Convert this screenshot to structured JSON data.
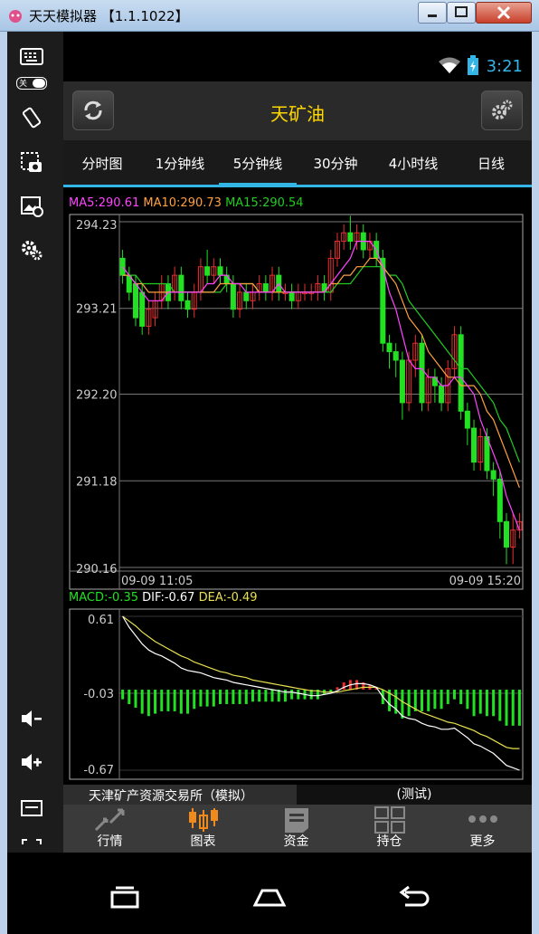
{
  "window": {
    "title": "天天模拟器 【1.1.1022】"
  },
  "status": {
    "time": "3:21"
  },
  "toolbar": {
    "keyboard_toggle": "关"
  },
  "header": {
    "title": "天矿油"
  },
  "tabs": [
    {
      "label": "分时图"
    },
    {
      "label": "1分钟线"
    },
    {
      "label": "5分钟线",
      "active": true
    },
    {
      "label": "30分钟"
    },
    {
      "label": "4小时线"
    },
    {
      "label": "日线"
    }
  ],
  "ma_legend": {
    "ma5": "MA5:290.61",
    "ma10": "MA10:290.73",
    "ma15": "MA15:290.54"
  },
  "macd_legend": {
    "macd": "MACD:-0.35",
    "dif": "DIF:-0.67",
    "dea": "DEA:-0.49"
  },
  "price_axis": [
    "294.23",
    "293.21",
    "292.20",
    "291.18",
    "290.16"
  ],
  "macd_axis": [
    "0.61",
    "-0.03",
    "-0.67"
  ],
  "time_axis": {
    "start": "09-09 11:05",
    "end": "09-09 15:20"
  },
  "colors": {
    "up": "#e83030",
    "down": "#22e022",
    "ma5": "#ff44ff",
    "ma10": "#ffa040",
    "ma15": "#22cc22",
    "dif": "#ffffff",
    "dea": "#e8e050",
    "accent": "#33b5e5",
    "title": "#ffd700"
  },
  "footer": {
    "exchange": "天津矿产资源交易所（模拟）",
    "mode": "(测试)"
  },
  "bottom_nav": [
    {
      "label": "行情",
      "icon": "market-icon"
    },
    {
      "label": "图表",
      "icon": "candlestick-icon",
      "active": true
    },
    {
      "label": "资金",
      "icon": "funds-icon"
    },
    {
      "label": "持仓",
      "icon": "positions-icon"
    },
    {
      "label": "更多",
      "icon": "more-icon"
    }
  ],
  "chart_data": {
    "type": "candlestick",
    "price_ylim": [
      290.16,
      294.23
    ],
    "macd_ylim": [
      -0.67,
      0.61
    ],
    "candles": [
      [
        293.8,
        293.6,
        293.9,
        293.5
      ],
      [
        293.6,
        293.4,
        293.7,
        293.3
      ],
      [
        293.5,
        293.1,
        293.6,
        293.0
      ],
      [
        293.4,
        293.0,
        293.5,
        292.9
      ],
      [
        293.0,
        293.2,
        293.3,
        292.9
      ],
      [
        293.1,
        293.3,
        293.4,
        293.0
      ],
      [
        293.3,
        293.5,
        293.6,
        293.2
      ],
      [
        293.5,
        293.3,
        293.6,
        293.2
      ],
      [
        293.4,
        293.6,
        293.7,
        293.3
      ],
      [
        293.6,
        293.3,
        293.7,
        293.2
      ],
      [
        293.3,
        293.2,
        293.4,
        293.1
      ],
      [
        293.2,
        293.4,
        293.5,
        293.1
      ],
      [
        293.4,
        293.7,
        293.8,
        293.3
      ],
      [
        293.7,
        293.6,
        293.9,
        293.5
      ],
      [
        293.6,
        293.7,
        293.8,
        293.5
      ],
      [
        293.7,
        293.6,
        293.8,
        293.5
      ],
      [
        293.6,
        293.5,
        293.7,
        293.4
      ],
      [
        293.5,
        293.2,
        293.6,
        293.1
      ],
      [
        293.2,
        293.4,
        293.5,
        293.1
      ],
      [
        293.4,
        293.3,
        293.5,
        293.2
      ],
      [
        293.3,
        293.4,
        293.5,
        293.2
      ],
      [
        293.4,
        293.5,
        293.6,
        293.3
      ],
      [
        293.5,
        293.4,
        293.6,
        293.3
      ],
      [
        293.4,
        293.6,
        293.7,
        293.3
      ],
      [
        293.6,
        293.4,
        293.7,
        293.3
      ],
      [
        293.4,
        293.4,
        293.5,
        293.3
      ],
      [
        293.4,
        293.3,
        293.5,
        293.2
      ],
      [
        293.3,
        293.4,
        293.5,
        293.2
      ],
      [
        293.4,
        293.4,
        293.5,
        293.3
      ],
      [
        293.4,
        293.4,
        293.5,
        293.3
      ],
      [
        293.4,
        293.5,
        293.6,
        293.3
      ],
      [
        293.5,
        293.4,
        293.6,
        293.3
      ],
      [
        293.4,
        293.8,
        293.9,
        293.3
      ],
      [
        293.8,
        294.0,
        294.1,
        293.7
      ],
      [
        294.0,
        294.1,
        294.2,
        293.9
      ],
      [
        294.1,
        294.0,
        294.3,
        293.9
      ],
      [
        294.0,
        294.1,
        294.2,
        293.9
      ],
      [
        294.1,
        293.9,
        294.2,
        293.8
      ],
      [
        293.9,
        294.0,
        294.1,
        293.8
      ],
      [
        294.0,
        293.8,
        294.1,
        293.7
      ],
      [
        293.8,
        292.8,
        293.9,
        292.7
      ],
      [
        292.8,
        292.7,
        292.9,
        292.5
      ],
      [
        292.7,
        292.6,
        292.8,
        292.4
      ],
      [
        292.6,
        292.1,
        292.7,
        291.9
      ],
      [
        292.1,
        292.6,
        292.7,
        292.0
      ],
      [
        292.6,
        292.8,
        292.9,
        292.4
      ],
      [
        292.8,
        292.1,
        292.9,
        292.0
      ],
      [
        292.1,
        292.4,
        292.5,
        292.0
      ],
      [
        292.4,
        292.3,
        292.5,
        292.1
      ],
      [
        292.3,
        292.1,
        292.4,
        292.0
      ],
      [
        292.1,
        292.5,
        292.6,
        292.0
      ],
      [
        292.5,
        292.9,
        293.0,
        292.4
      ],
      [
        292.9,
        292.0,
        293.0,
        291.9
      ],
      [
        292.0,
        291.8,
        292.1,
        291.6
      ],
      [
        291.8,
        291.4,
        291.9,
        291.3
      ],
      [
        291.4,
        291.7,
        291.8,
        291.3
      ],
      [
        291.7,
        291.3,
        291.8,
        291.2
      ],
      [
        291.3,
        291.2,
        291.4,
        291.0
      ],
      [
        291.2,
        290.7,
        291.3,
        290.5
      ],
      [
        290.7,
        290.4,
        290.8,
        290.2
      ],
      [
        290.4,
        290.6,
        290.8,
        290.2
      ],
      [
        290.6,
        290.7,
        290.8,
        290.5
      ]
    ],
    "ma5": [
      293.7,
      293.6,
      293.5,
      293.4,
      293.3,
      293.3,
      293.3,
      293.4,
      293.4,
      293.4,
      293.4,
      293.4,
      293.4,
      293.5,
      293.5,
      293.6,
      293.6,
      293.5,
      293.5,
      293.4,
      293.4,
      293.4,
      293.4,
      293.4,
      293.5,
      293.4,
      293.4,
      293.4,
      293.4,
      293.4,
      293.4,
      293.4,
      293.5,
      293.6,
      293.7,
      293.8,
      294.0,
      294.0,
      294.0,
      293.9,
      293.7,
      293.4,
      293.2,
      292.9,
      292.6,
      292.5,
      292.5,
      292.4,
      292.4,
      292.3,
      292.3,
      292.4,
      292.4,
      292.3,
      292.2,
      291.9,
      291.7,
      291.5,
      291.3,
      291.0,
      290.8,
      290.6
    ],
    "ma10": [
      293.6,
      293.6,
      293.5,
      293.5,
      293.4,
      293.4,
      293.4,
      293.4,
      293.4,
      293.4,
      293.4,
      293.4,
      293.4,
      293.4,
      293.4,
      293.5,
      293.5,
      293.5,
      293.5,
      293.5,
      293.5,
      293.4,
      293.4,
      293.4,
      293.4,
      293.4,
      293.4,
      293.4,
      293.4,
      293.4,
      293.4,
      293.4,
      293.5,
      293.5,
      293.6,
      293.6,
      293.7,
      293.7,
      293.8,
      293.8,
      293.7,
      293.6,
      293.5,
      293.3,
      293.1,
      293.0,
      292.9,
      292.7,
      292.6,
      292.5,
      292.4,
      292.4,
      292.3,
      292.3,
      292.3,
      292.2,
      292.0,
      291.9,
      291.7,
      291.5,
      291.3,
      291.1
    ],
    "ma15": [
      293.6,
      293.6,
      293.6,
      293.5,
      293.5,
      293.5,
      293.5,
      293.5,
      293.4,
      293.4,
      293.4,
      293.4,
      293.4,
      293.4,
      293.4,
      293.4,
      293.5,
      293.5,
      293.5,
      293.5,
      293.5,
      293.4,
      293.4,
      293.4,
      293.4,
      293.4,
      293.4,
      293.4,
      293.4,
      293.4,
      293.4,
      293.4,
      293.4,
      293.5,
      293.5,
      293.5,
      293.6,
      293.7,
      293.7,
      293.7,
      293.7,
      293.6,
      293.6,
      293.5,
      293.3,
      293.2,
      293.1,
      293.0,
      292.9,
      292.8,
      292.7,
      292.6,
      292.5,
      292.5,
      292.4,
      292.3,
      292.2,
      292.1,
      291.9,
      291.8,
      291.6,
      291.4
    ],
    "dif": [
      0.61,
      0.52,
      0.45,
      0.38,
      0.33,
      0.3,
      0.28,
      0.25,
      0.22,
      0.18,
      0.16,
      0.15,
      0.14,
      0.12,
      0.1,
      0.09,
      0.08,
      0.06,
      0.05,
      0.04,
      0.03,
      0.02,
      0.01,
      0.0,
      -0.01,
      -0.02,
      -0.02,
      -0.03,
      -0.04,
      -0.05,
      -0.05,
      -0.04,
      -0.03,
      -0.01,
      0.02,
      0.04,
      0.05,
      0.05,
      0.04,
      0.02,
      -0.06,
      -0.12,
      -0.16,
      -0.22,
      -0.24,
      -0.25,
      -0.28,
      -0.3,
      -0.31,
      -0.33,
      -0.33,
      -0.32,
      -0.36,
      -0.4,
      -0.45,
      -0.47,
      -0.5,
      -0.53,
      -0.58,
      -0.63,
      -0.65,
      -0.67
    ],
    "dea": [
      0.61,
      0.57,
      0.53,
      0.48,
      0.44,
      0.4,
      0.37,
      0.34,
      0.31,
      0.28,
      0.26,
      0.23,
      0.21,
      0.19,
      0.17,
      0.15,
      0.14,
      0.12,
      0.11,
      0.1,
      0.08,
      0.07,
      0.06,
      0.05,
      0.04,
      0.03,
      0.02,
      0.01,
      0.0,
      -0.01,
      -0.01,
      -0.02,
      -0.02,
      -0.02,
      -0.01,
      0.0,
      0.01,
      0.02,
      0.02,
      0.02,
      0.0,
      -0.03,
      -0.06,
      -0.1,
      -0.13,
      -0.16,
      -0.19,
      -0.21,
      -0.23,
      -0.25,
      -0.27,
      -0.28,
      -0.3,
      -0.32,
      -0.34,
      -0.37,
      -0.39,
      -0.42,
      -0.45,
      -0.48,
      -0.49,
      -0.49
    ],
    "macd": [
      -0.08,
      -0.12,
      -0.15,
      -0.2,
      -0.22,
      -0.2,
      -0.18,
      -0.18,
      -0.18,
      -0.2,
      -0.2,
      -0.16,
      -0.14,
      -0.14,
      -0.14,
      -0.12,
      -0.12,
      -0.12,
      -0.12,
      -0.12,
      -0.1,
      -0.1,
      -0.1,
      -0.1,
      -0.1,
      -0.1,
      -0.08,
      -0.08,
      -0.08,
      -0.08,
      -0.08,
      -0.04,
      -0.02,
      0.02,
      0.06,
      0.08,
      0.08,
      0.06,
      0.04,
      0.02,
      -0.12,
      -0.18,
      -0.2,
      -0.24,
      -0.22,
      -0.18,
      -0.18,
      -0.18,
      -0.16,
      -0.16,
      -0.12,
      -0.08,
      -0.12,
      -0.16,
      -0.22,
      -0.2,
      -0.22,
      -0.22,
      -0.26,
      -0.3,
      -0.3,
      -0.3
    ]
  }
}
